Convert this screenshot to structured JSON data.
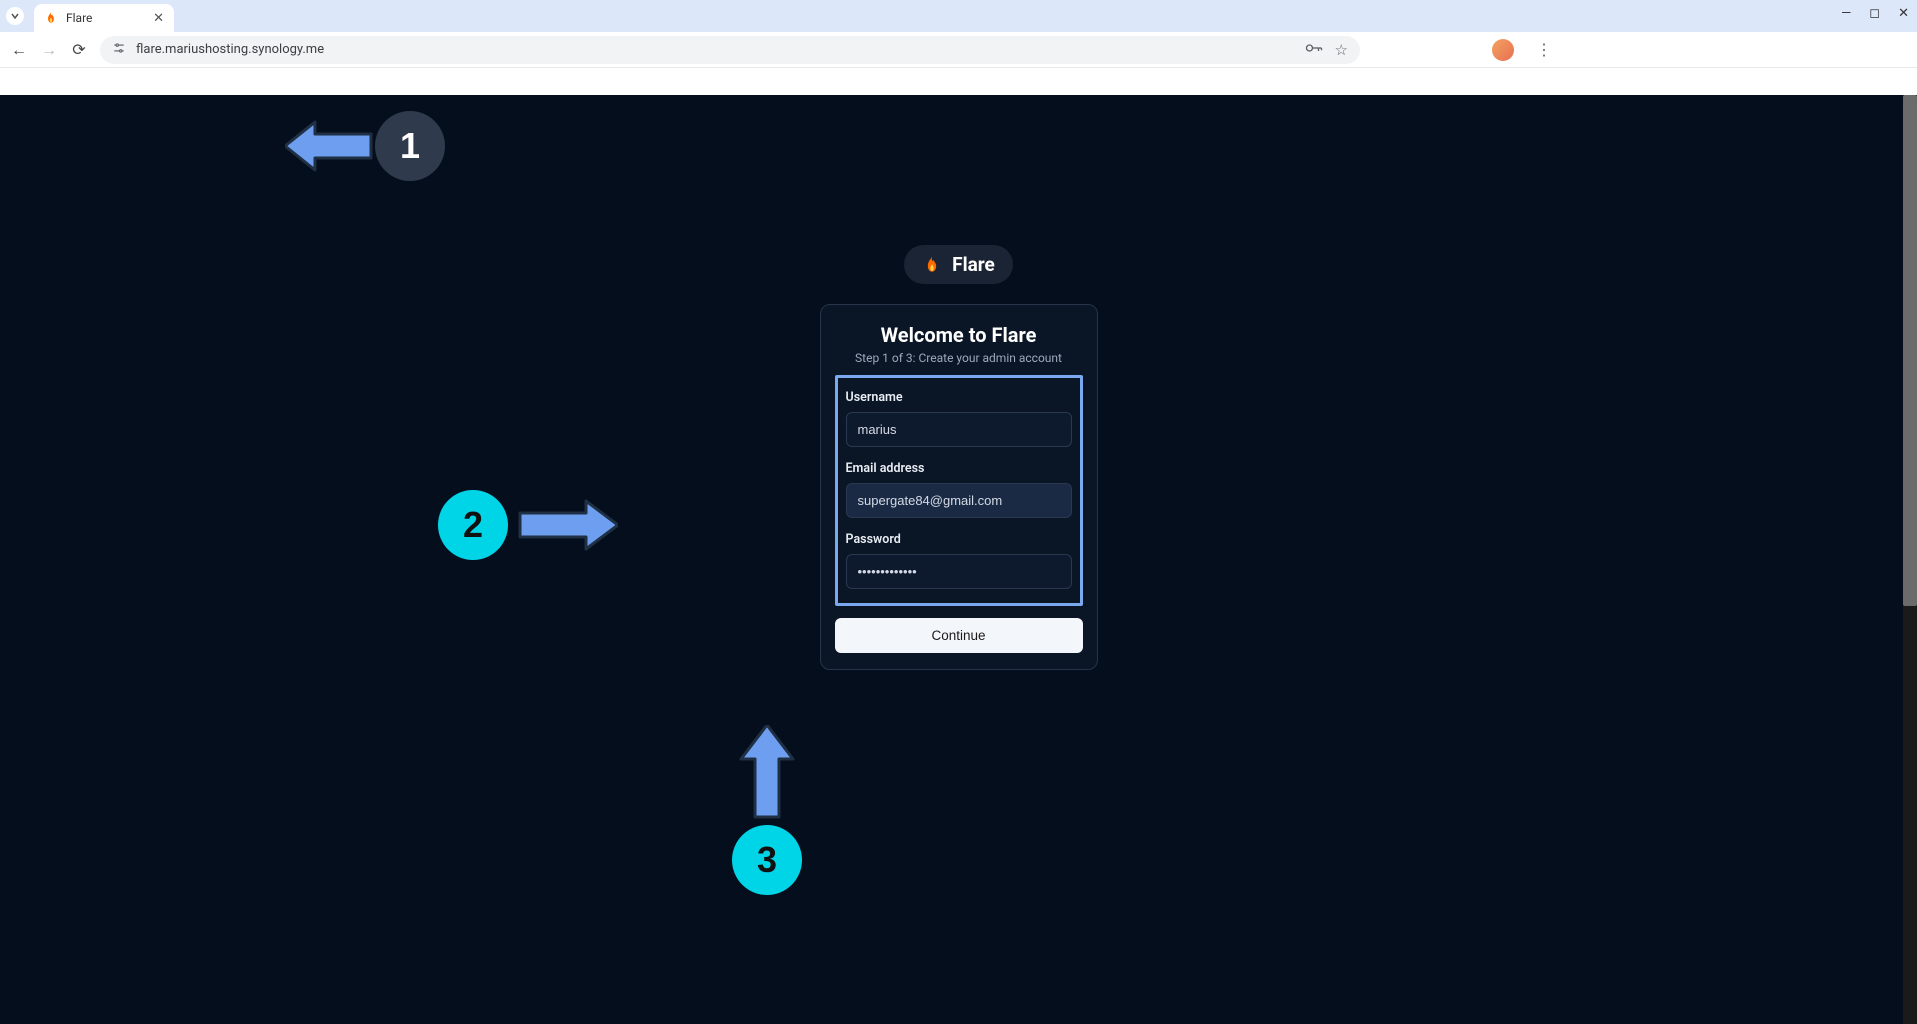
{
  "browser": {
    "tab_title": "Flare",
    "url": "flare.mariushosting.synology.me"
  },
  "brand": {
    "name": "Flare"
  },
  "card": {
    "heading": "Welcome to Flare",
    "subtitle": "Step 1 of 3: Create your admin account",
    "username_label": "Username",
    "username_value": "marius",
    "email_label": "Email address",
    "email_value": "supergate84@gmail.com",
    "password_label": "Password",
    "password_value": "•••••••••••••",
    "continue_label": "Continue"
  },
  "annotations": {
    "one": "1",
    "two": "2",
    "three": "3"
  }
}
